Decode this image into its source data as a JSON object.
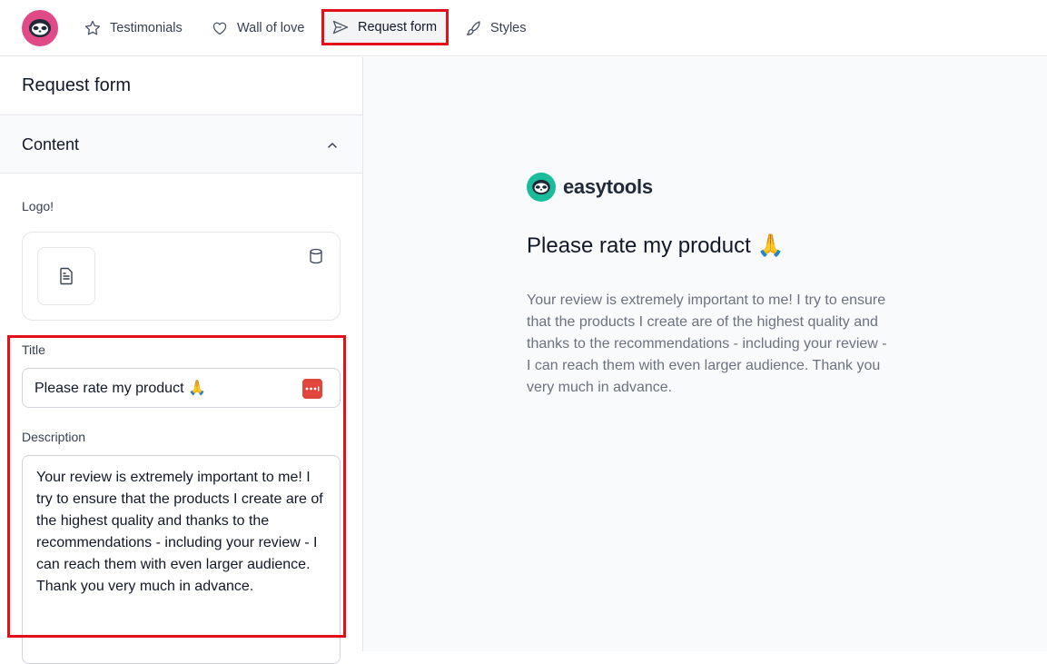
{
  "nav": {
    "items": [
      {
        "label": "Testimonials",
        "icon": "star-icon"
      },
      {
        "label": "Wall of love",
        "icon": "heart-icon"
      },
      {
        "label": "Request form",
        "icon": "send-icon",
        "active": true
      },
      {
        "label": "Styles",
        "icon": "brush-icon"
      }
    ]
  },
  "panel": {
    "title": "Request form",
    "section_title": "Content",
    "logo_label": "Logo!",
    "title_label": "Title",
    "title_value": "Please rate my product 🙏",
    "description_label": "Description",
    "description_value": "Your review is extremely important to me! I try to ensure that the products I create are of the highest quality and thanks to the recommendations - including your review - I can reach them with even larger audience. Thank you very much in advance."
  },
  "preview": {
    "brand_name": "easytools",
    "title": "Please rate my product 🙏",
    "description": "Your review is extremely important to me! I try to ensure that the products I create are of the highest quality and thanks to the recommendations - including your review - I can reach them with even larger audience. Thank you very much in advance."
  },
  "colors": {
    "accent_highlight": "#e3101b",
    "logo_badge": "#e04a86",
    "brand_badge": "#1abc9c"
  }
}
